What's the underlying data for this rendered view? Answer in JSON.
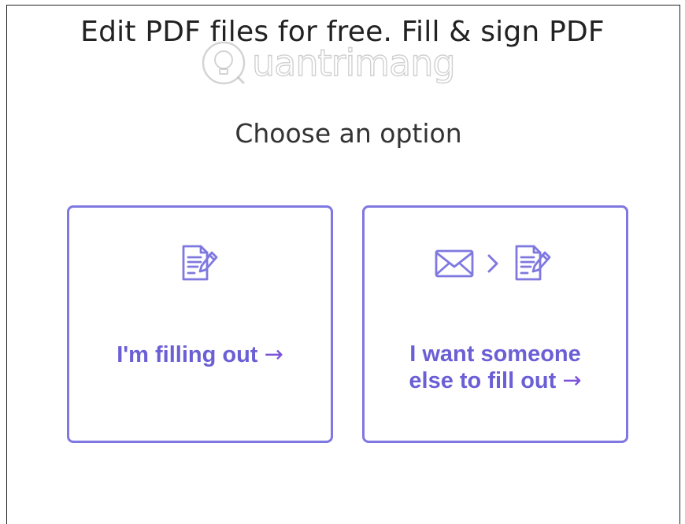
{
  "header": {
    "title": "Edit PDF files for free. Fill & sign PDF"
  },
  "watermark": {
    "text": "uantrimang"
  },
  "main": {
    "subtitle": "Choose an option",
    "options": [
      {
        "label": "I'm filling out",
        "arrow": "→",
        "icons": [
          "document-edit-icon"
        ]
      },
      {
        "label_line1": "I want someone",
        "label_line2": "else to fill out",
        "arrow": "→",
        "icons": [
          "envelope-icon",
          "chevron-right-icon",
          "document-edit-icon"
        ]
      }
    ]
  },
  "colors": {
    "accent": "#7f78e0",
    "label": "#6b5fd6",
    "arrow": "#7b52d9"
  }
}
